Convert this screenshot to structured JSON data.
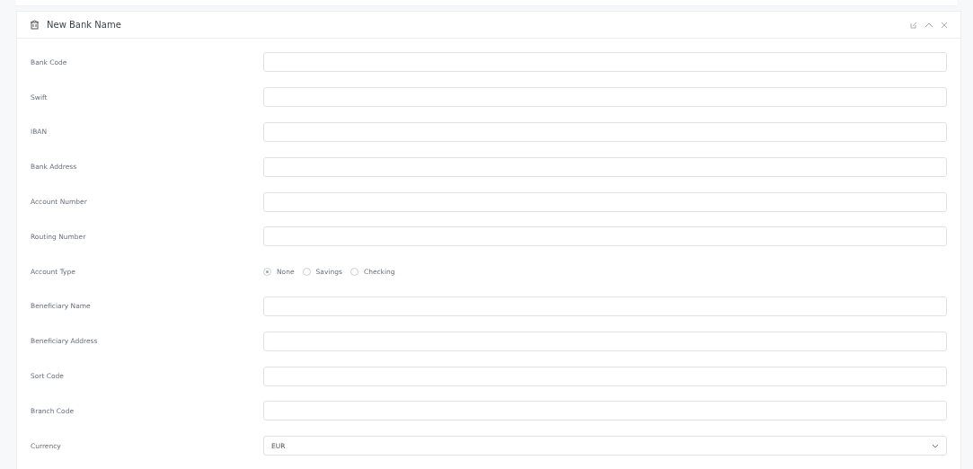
{
  "panel": {
    "title": "New Bank Name"
  },
  "fields": [
    {
      "kind": "text",
      "label": "Bank Code"
    },
    {
      "kind": "text",
      "label": "Swift"
    },
    {
      "kind": "text",
      "label": "IBAN"
    },
    {
      "kind": "text",
      "label": "Bank Address"
    },
    {
      "kind": "text",
      "label": "Account Number"
    },
    {
      "kind": "text",
      "label": "Routing Number"
    },
    {
      "kind": "radio",
      "label": "Account Type",
      "options": [
        {
          "label": "None",
          "selected": true
        },
        {
          "label": "Savings",
          "selected": false
        },
        {
          "label": "Checking",
          "selected": false
        }
      ]
    },
    {
      "kind": "text",
      "label": "Beneficiary Name"
    },
    {
      "kind": "text",
      "label": "Beneficiary Address"
    },
    {
      "kind": "text",
      "label": "Sort Code"
    },
    {
      "kind": "text",
      "label": "Branch Code"
    },
    {
      "kind": "select",
      "label": "Currency",
      "value": "EUR"
    }
  ]
}
